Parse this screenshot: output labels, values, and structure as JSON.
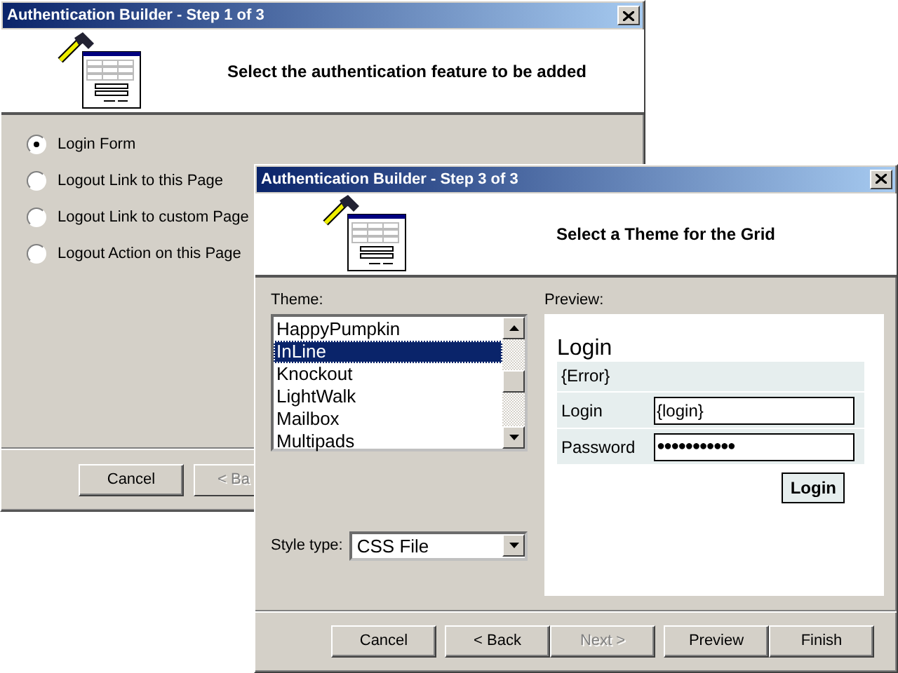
{
  "step1_window": {
    "title": "Authentication Builder - Step 1 of 3",
    "heading": "Select the authentication feature to be added",
    "options": [
      {
        "label": "Login Form",
        "selected": true
      },
      {
        "label": "Logout Link to this Page",
        "selected": false
      },
      {
        "label": "Logout Link to custom Page",
        "selected": false
      },
      {
        "label": "Logout Action on this Page",
        "selected": false
      }
    ],
    "buttons": [
      {
        "label": "Cancel",
        "disabled": false
      },
      {
        "label": "< Ba",
        "disabled": true
      }
    ]
  },
  "step3_window": {
    "title": "Authentication Builder - Step 3 of 3",
    "heading": "Select a Theme for the Grid",
    "theme_label": "Theme:",
    "themes": [
      {
        "label": "HappyPumpkin",
        "selected": false
      },
      {
        "label": "InLine",
        "selected": true
      },
      {
        "label": "Knockout",
        "selected": false
      },
      {
        "label": "LightWalk",
        "selected": false
      },
      {
        "label": "Mailbox",
        "selected": false
      },
      {
        "label": "Multipads",
        "selected": false
      }
    ],
    "style_type_label": "Style type:",
    "style_type": "CSS File",
    "preview_label": "Preview:",
    "preview": {
      "heading": "Login",
      "error": "{Error}",
      "fields": [
        {
          "label": "Login",
          "value": "{login}",
          "kind": "text"
        },
        {
          "label": "Password",
          "value": "●●●●●●●●●●●",
          "kind": "password"
        }
      ],
      "button": "Login"
    },
    "buttons": [
      {
        "label": "Cancel",
        "disabled": false
      },
      {
        "label": "< Back",
        "disabled": false
      },
      {
        "label": "Next >",
        "disabled": true
      },
      {
        "label": "Preview",
        "disabled": false
      },
      {
        "label": "Finish",
        "disabled": false
      }
    ]
  }
}
